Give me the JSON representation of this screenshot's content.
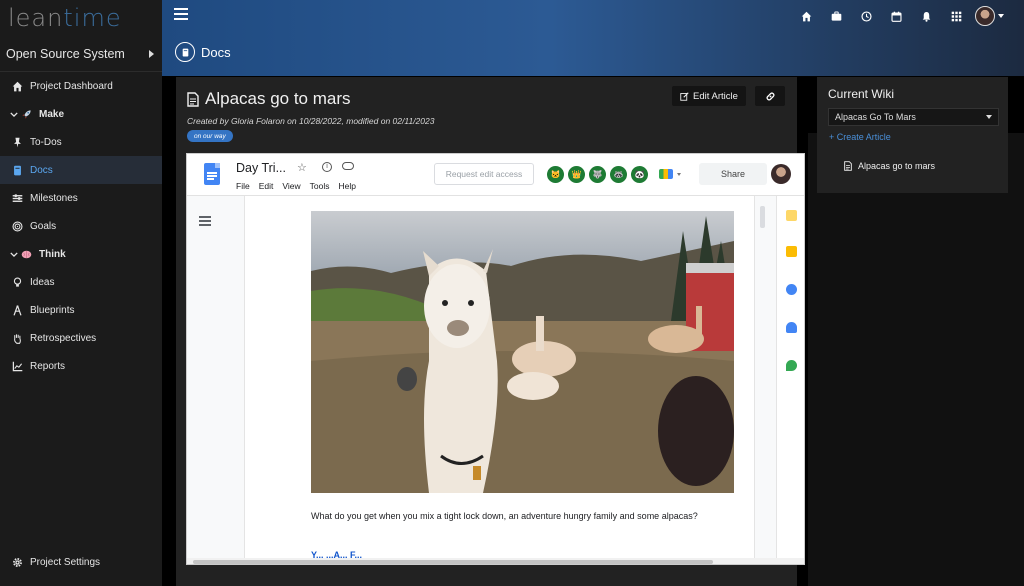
{
  "sidebar": {
    "logo": "leantime",
    "project": "Open Source System",
    "items": [
      {
        "label": "Project Dashboard",
        "icon": "home-icon",
        "type": "item"
      },
      {
        "label": "Make",
        "icon": "rocket-icon",
        "type": "group"
      },
      {
        "label": "To-Dos",
        "icon": "pin-icon",
        "type": "item"
      },
      {
        "label": "Docs",
        "icon": "book-icon",
        "type": "item",
        "active": true
      },
      {
        "label": "Milestones",
        "icon": "sliders-icon",
        "type": "item"
      },
      {
        "label": "Goals",
        "icon": "target-icon",
        "type": "item"
      },
      {
        "label": "Think",
        "icon": "brain-icon",
        "type": "group"
      },
      {
        "label": "Ideas",
        "icon": "lightbulb-icon",
        "type": "item"
      },
      {
        "label": "Blueprints",
        "icon": "compass-icon",
        "type": "item"
      },
      {
        "label": "Retrospectives",
        "icon": "hand-icon",
        "type": "item"
      },
      {
        "label": "Reports",
        "icon": "chart-icon",
        "type": "item"
      }
    ],
    "settings": "Project Settings"
  },
  "header": {
    "page_title": "Docs"
  },
  "article": {
    "title": "Alpacas go to mars",
    "meta": "Created by Gloria Folaron on 10/28/2022, modified on 02/11/2023",
    "tag": "on our way",
    "edit_label": "Edit Article"
  },
  "gdoc": {
    "title": "Day Tri...",
    "menu": [
      "File",
      "Edit",
      "View",
      "Tools",
      "Help"
    ],
    "request_access": "Request edit access",
    "share": "Share",
    "body_text": "What do you get when you mix a tight lock down, an adventure hungry family and some alpacas?",
    "body_text2": "Y... ...A... F..."
  },
  "wiki": {
    "title": "Current Wiki",
    "selected": "Alpacas Go To Mars",
    "create": "Create Article",
    "article": "Alpacas go to mars"
  },
  "colors": {
    "accent": "#3474c4",
    "active_nav": "#5ba7f0",
    "sidebar_bg": "#1b1b1b",
    "panel_bg": "#222222"
  }
}
